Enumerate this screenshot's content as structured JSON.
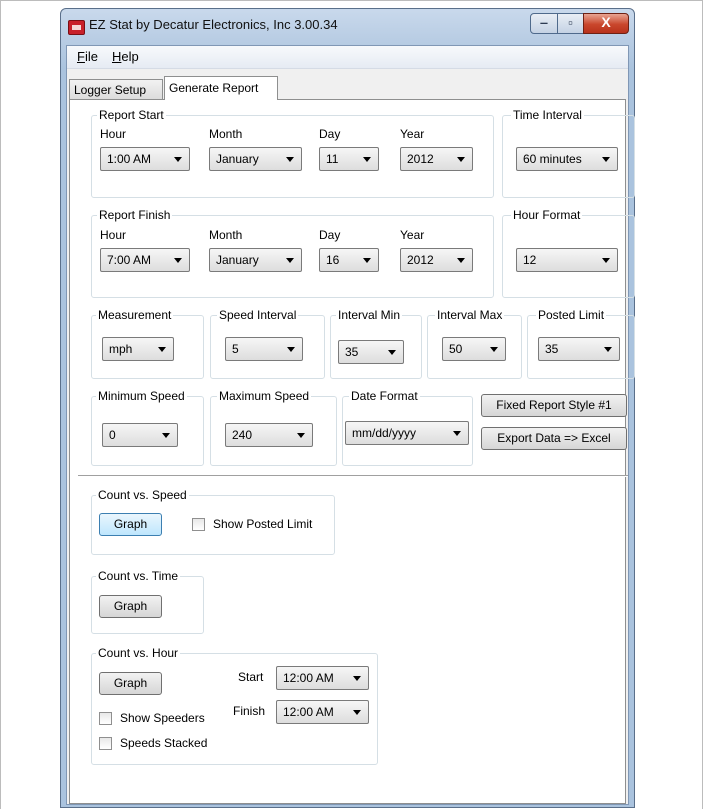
{
  "window": {
    "title": "EZ Stat  by  Decatur Electronics, Inc  3.00.34",
    "minimize_glyph": "‒",
    "maximize_glyph": "▫",
    "close_glyph": "X"
  },
  "menu": [
    {
      "accel": "F",
      "rest": "ile"
    },
    {
      "accel": "H",
      "rest": "elp"
    }
  ],
  "tabs": [
    "Logger Setup",
    "Generate Report"
  ],
  "report_start": {
    "legend": "Report Start",
    "hour_label": "Hour",
    "hour": "1:00 AM",
    "month_label": "Month",
    "month": "January",
    "day_label": "Day",
    "day": "11",
    "year_label": "Year",
    "year": "2012"
  },
  "time_interval": {
    "legend": "Time Interval",
    "value": "60  minutes"
  },
  "report_finish": {
    "legend": "Report Finish",
    "hour_label": "Hour",
    "hour": "7:00 AM",
    "month_label": "Month",
    "month": "January",
    "day_label": "Day",
    "day": "16",
    "year_label": "Year",
    "year": "2012"
  },
  "hour_format": {
    "legend": "Hour Format",
    "value": "12"
  },
  "measurement": {
    "legend": "Measurement",
    "value": "mph"
  },
  "speed_interval": {
    "legend": "Speed Interval",
    "value": "5"
  },
  "interval_min": {
    "legend": "Interval Min",
    "value": "35"
  },
  "interval_max": {
    "legend": "Interval Max",
    "value": "50"
  },
  "posted_limit": {
    "legend": "Posted Limit",
    "value": "35"
  },
  "minimum_speed": {
    "legend": "Minimum Speed",
    "value": "0"
  },
  "maximum_speed": {
    "legend": "Maximum Speed",
    "value": "240"
  },
  "date_format": {
    "legend": "Date Format",
    "value": "mm/dd/yyyy"
  },
  "buttons": {
    "fixed_report": "Fixed Report Style #1",
    "export": "Export Data => Excel"
  },
  "count_vs_speed": {
    "legend": "Count vs. Speed",
    "graph": "Graph",
    "show_posted_limit": "Show Posted Limit"
  },
  "count_vs_time": {
    "legend": "Count vs. Time",
    "graph": "Graph"
  },
  "count_vs_hour": {
    "legend": "Count vs. Hour",
    "graph": "Graph",
    "start_label": "Start",
    "start": "12:00 AM",
    "finish_label": "Finish",
    "finish": "12:00 AM",
    "show_speeders": "Show Speeders",
    "speeds_stacked": "Speeds Stacked"
  }
}
